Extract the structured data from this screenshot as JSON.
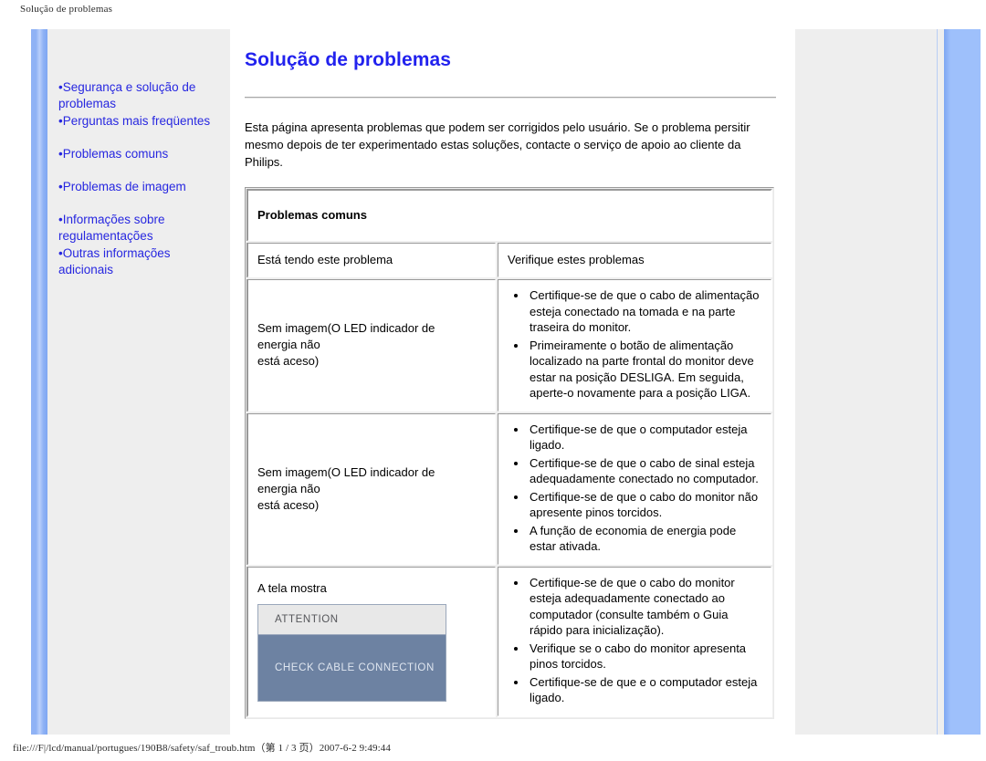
{
  "browser": {
    "header_title": "Solução de problemas",
    "footer_text": "file:///F|/lcd/manual/portugues/190B8/safety/saf_troub.htm（第 1 / 3 页）2007-6-2 9:49:44"
  },
  "sidebar": {
    "groups": [
      {
        "items": [
          {
            "label": "Segurança e solução de problemas"
          },
          {
            "label": "Perguntas mais freqüentes"
          }
        ]
      },
      {
        "items": [
          {
            "label": "Problemas comuns"
          }
        ]
      },
      {
        "items": [
          {
            "label": "Problemas de imagem"
          }
        ]
      },
      {
        "items": [
          {
            "label": "Informações sobre regulamentações"
          },
          {
            "label": "Outras informações adicionais"
          }
        ]
      }
    ]
  },
  "main": {
    "title": "Solução de problemas",
    "intro": "Esta página apresenta problemas que podem ser corrigidos pelo usuário. Se o problema persitir mesmo depois de ter experimentado estas soluções, contacte o serviço de apoio ao cliente da Philips.",
    "table": {
      "section_title": "Problemas comuns",
      "columns": {
        "symptom": "Está tendo este problema",
        "checks": "Verifique estes problemas"
      },
      "rows": [
        {
          "symptom_lines": [
            "Sem imagem(O LED indicador de",
            "energia não",
            "está aceso)"
          ],
          "checks": [
            "Certifique-se de que o cabo de alimentação esteja conectado na tomada e na parte traseira do monitor.",
            "Primeiramente o botão de alimentação localizado na parte frontal do monitor deve estar na posição DESLIGA. Em seguida, aperte-o novamente para a posição LIGA."
          ]
        },
        {
          "symptom_lines": [
            "Sem imagem(O LED indicador de",
            "energia não",
            "está aceso)"
          ],
          "checks": [
            "Certifique-se de que o computador esteja ligado.",
            "Certifique-se de que o cabo de sinal esteja adequadamente conectado no computador.",
            "Certifique-se de que o cabo do monitor não apresente pinos torcidos.",
            "A função de economia de energia pode estar ativada."
          ]
        },
        {
          "symptom_lines": [
            "A tela mostra"
          ],
          "osd": {
            "title": "ATTENTION",
            "message": "CHECK CABLE CONNECTION"
          },
          "checks": [
            "Certifique-se de que o cabo do monitor esteja adequadamente conectado ao computador (consulte também o Guia rápido para inicialização).",
            "Verifique se o cabo do monitor apresenta pinos torcidos.",
            "Certifique-se de que e o computador esteja ligado."
          ]
        }
      ]
    }
  },
  "colors": {
    "link": "#2727e0",
    "heading": "#2222ee",
    "sidebar_bg": "#eeeeee",
    "accent_bar": "#8fb2f5",
    "osd_body": "#6d82a2"
  }
}
